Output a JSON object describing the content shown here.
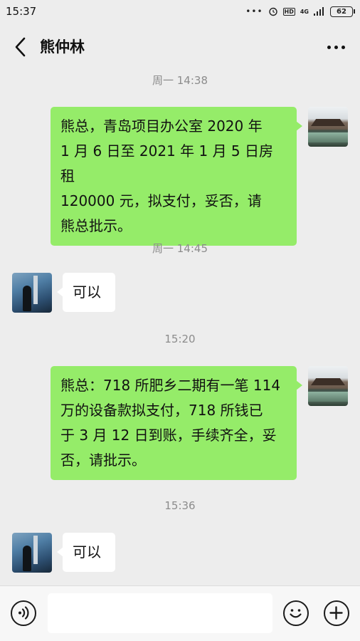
{
  "status_bar": {
    "time": "15:37",
    "dots": "•••",
    "network": "4G",
    "battery": "62"
  },
  "chat": {
    "title": "熊仲林",
    "messages": [
      {
        "type": "timestamp",
        "text": "周一 14:38"
      },
      {
        "type": "outgoing",
        "lines": [
          "熊总，青岛项目办公室 2020 年",
          "1 月 6 日至 2021 年 1 月 5 日房租",
          "120000 元，拟支付，妥否，请",
          "熊总批示。"
        ]
      },
      {
        "type": "timestamp",
        "text": "周一 14:45"
      },
      {
        "type": "incoming",
        "lines": [
          "可以"
        ]
      },
      {
        "type": "timestamp",
        "text": "15:20"
      },
      {
        "type": "outgoing",
        "lines": [
          "熊总：718 所肥乡二期有一笔 114",
          "万的设备款拟支付，718 所钱已",
          "于 3 月 12 日到账，手续齐全，妥",
          "否，请批示。"
        ]
      },
      {
        "type": "timestamp",
        "text": "15:36"
      },
      {
        "type": "incoming",
        "lines": [
          "可以"
        ]
      }
    ]
  },
  "input": {
    "value": "",
    "placeholder": ""
  },
  "icons": {
    "back": "chevron-left-icon",
    "more": "more-dots-icon",
    "voice": "voice-icon",
    "emoji": "emoji-icon",
    "plus": "plus-icon"
  },
  "colors": {
    "outgoing_bubble": "#95ec69",
    "incoming_bubble": "#ffffff",
    "background": "#ededed"
  }
}
